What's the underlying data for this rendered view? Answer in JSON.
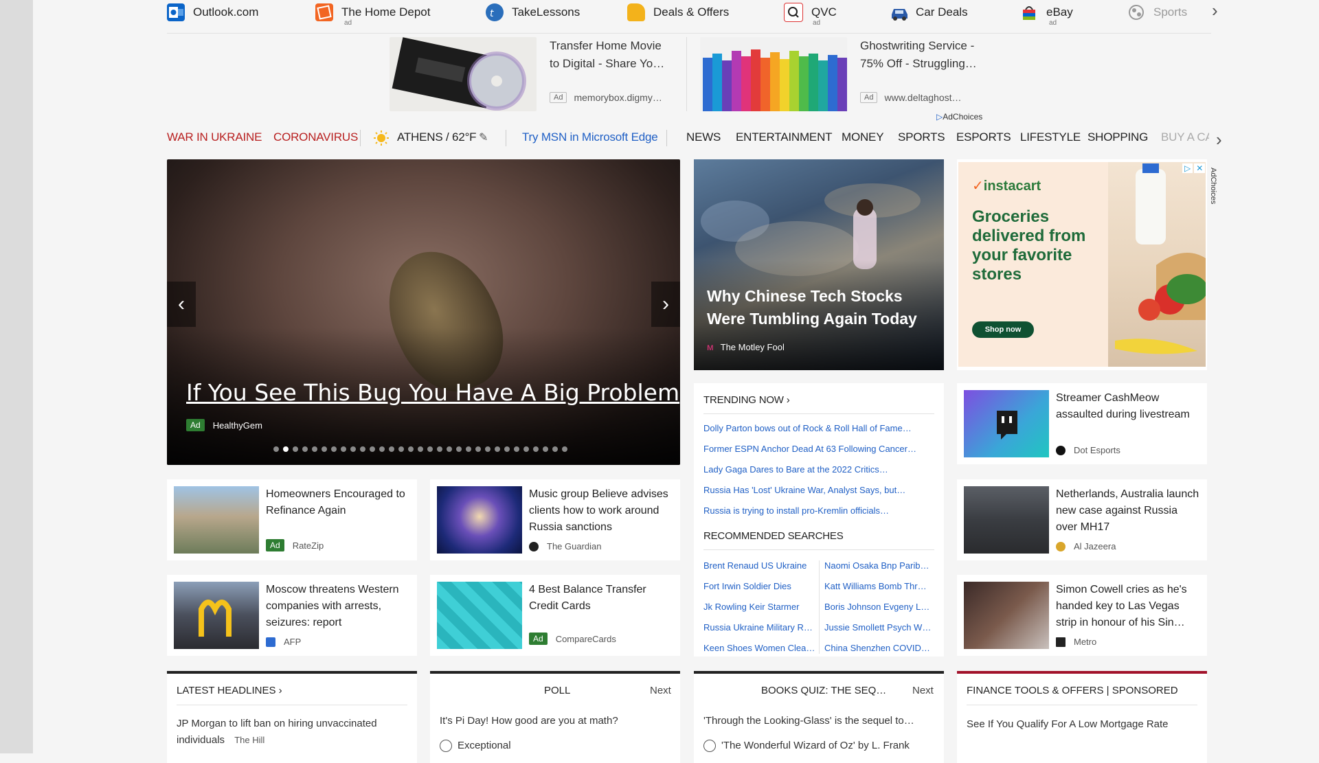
{
  "quicklinks": {
    "items": [
      {
        "label": "Outlook.com",
        "icon": "outlook-icon",
        "ad": ""
      },
      {
        "label": "The Home Depot",
        "icon": "home-depot-icon",
        "ad": "ad"
      },
      {
        "label": "TakeLessons",
        "icon": "takelessons-icon",
        "ad": ""
      },
      {
        "label": "Deals & Offers",
        "icon": "deals-tag-icon",
        "ad": ""
      },
      {
        "label": "QVC",
        "icon": "qvc-icon",
        "ad": "ad"
      },
      {
        "label": "Car Deals",
        "icon": "car-icon",
        "ad": ""
      },
      {
        "label": "eBay",
        "icon": "ebay-bag-icon",
        "ad": "ad"
      },
      {
        "label": "Sports",
        "icon": "sports-icon",
        "ad": ""
      }
    ]
  },
  "top_ads": [
    {
      "title_line1": "Transfer Home Movie",
      "title_line2": "to Digital - Share Yo…",
      "ad_tag": "Ad",
      "source": "memorybox.digmy…"
    },
    {
      "title_line1": "Ghostwriting Service -",
      "title_line2": "75% Off - Struggling…",
      "ad_tag": "Ad",
      "source": "www.deltaghost…"
    }
  ],
  "adchoices": "AdChoices",
  "nav": {
    "war": "WAR IN UKRAINE",
    "corona": "CORONAVIRUS",
    "weather": "ATHENS / 62°F",
    "edge": "Try MSN in Microsoft Edge",
    "items": [
      "NEWS",
      "ENTERTAINMENT",
      "MONEY",
      "SPORTS",
      "ESPORTS",
      "LIFESTYLE",
      "SHOPPING",
      "BUY A CA"
    ]
  },
  "hero": {
    "title": "If You See This Bug You Have A Big Problem",
    "ad_tag": "Ad",
    "source": "HealthyGem",
    "slide_count": 31,
    "active_slide": 2
  },
  "story": {
    "title": "Why Chinese Tech Stocks Were Tumbling Again Today",
    "source": "The Motley Fool"
  },
  "instacart_ad": {
    "brand": "instacart",
    "headline": "Groceries delivered from your favorite stores",
    "button": "Shop now"
  },
  "trending": {
    "heading": "TRENDING NOW",
    "items": [
      "Dolly Parton bows out of Rock & Roll Hall of Fame…",
      "Former ESPN Anchor Dead At 63 Following Cancer…",
      "Lady Gaga Dares to Bare at the 2022 Critics…",
      "Russia Has 'Lost' Ukraine War, Analyst Says, but…",
      "Russia is trying to install pro-Kremlin officials…"
    ],
    "rec_heading": "RECOMMENDED SEARCHES",
    "rec_left": [
      "Brent Renaud US Ukraine",
      "Fort Irwin Soldier Dies",
      "Jk Rowling Keir Starmer",
      "Russia Ukraine Military R…",
      "Keen Shoes Women Clea…"
    ],
    "rec_right": [
      "Naomi Osaka Bnp Parib…",
      "Katt Williams Bomb Thr…",
      "Boris Johnson Evgeny L…",
      "Jussie Smollett Psych W…",
      "China Shenzhen COVID…"
    ]
  },
  "cards": [
    {
      "title": "Homeowners Encouraged to Refinance Again",
      "ad": "Ad",
      "source": "RateZip"
    },
    {
      "title": "Music group Believe advises clients how to work around Russia sanctions",
      "ad": "",
      "source": "The Guardian"
    },
    {
      "title": "Streamer CashMeow assaulted during livestream",
      "ad": "",
      "source": "Dot Esports"
    },
    {
      "title": "Moscow threatens Western companies with arrests, seizures: report",
      "ad": "",
      "source": "AFP"
    },
    {
      "title": "4 Best Balance Transfer Credit Cards",
      "ad": "Ad",
      "source": "CompareCards"
    },
    {
      "title": "Netherlands, Australia launch new case against Russia over MH17",
      "ad": "",
      "source": "Al Jazeera"
    },
    {
      "title": "Simon Cowell cries as he's handed key to Las Vegas strip in honour of his Sin…",
      "ad": "",
      "source": "Metro"
    }
  ],
  "panels": {
    "latest": {
      "heading": "LATEST HEADLINES",
      "item": "JP Morgan to lift ban on hiring unvaccinated individuals",
      "source": "The Hill"
    },
    "poll": {
      "heading": "POLL",
      "next": "Next",
      "question": "It's Pi Day! How good are you at math?",
      "option": "Exceptional"
    },
    "quiz": {
      "heading": "BOOKS QUIZ: THE SEQ…",
      "next": "Next",
      "question": "'Through the Looking-Glass' is the sequel to…",
      "option": "'The Wonderful Wizard of Oz' by L. Frank"
    },
    "finance": {
      "heading": "FINANCE TOOLS & OFFERS | SPONSORED",
      "item": "See If You Qualify For A Low Mortgage Rate"
    }
  },
  "colors": {
    "accent_red": "#b81f1f",
    "link_blue": "#1f5fc5",
    "ad_green": "#2e7d32",
    "instacart_green": "#1f6b3a"
  }
}
